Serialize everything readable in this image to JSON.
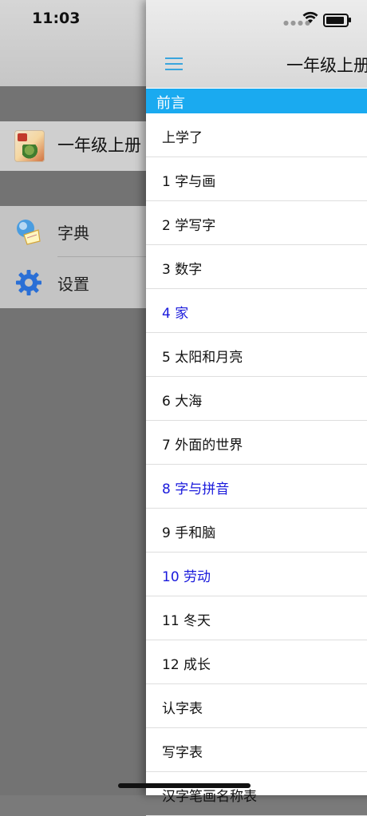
{
  "status": {
    "time": "11:03"
  },
  "drawer": {
    "book_title": "一年级上册",
    "menu": [
      {
        "label": "字典",
        "icon": "dictionary-icon"
      },
      {
        "label": "设置",
        "icon": "gear-icon"
      }
    ]
  },
  "header": {
    "title": "一年级上册",
    "menu_icon": "hamburger-icon"
  },
  "section": {
    "title": "前言"
  },
  "chapters": [
    {
      "label": "上学了",
      "highlight": false
    },
    {
      "label": "1 字与画",
      "highlight": false
    },
    {
      "label": "2 学写字",
      "highlight": false
    },
    {
      "label": "3 数字",
      "highlight": false
    },
    {
      "label": "4 家",
      "highlight": true
    },
    {
      "label": "5 太阳和月亮",
      "highlight": false
    },
    {
      "label": "6 大海",
      "highlight": false
    },
    {
      "label": "7 外面的世界",
      "highlight": false
    },
    {
      "label": "8 字与拼音",
      "highlight": true
    },
    {
      "label": "9 手和脑",
      "highlight": false
    },
    {
      "label": "10 劳动",
      "highlight": true
    },
    {
      "label": "11 冬天",
      "highlight": false
    },
    {
      "label": "12 成长",
      "highlight": false
    },
    {
      "label": "认字表",
      "highlight": false
    },
    {
      "label": "写字表",
      "highlight": false
    },
    {
      "label": "汉字笔画名称表",
      "highlight": false
    }
  ],
  "colors": {
    "accent": "#1aaaf0",
    "highlight_text": "#1a1adc"
  }
}
